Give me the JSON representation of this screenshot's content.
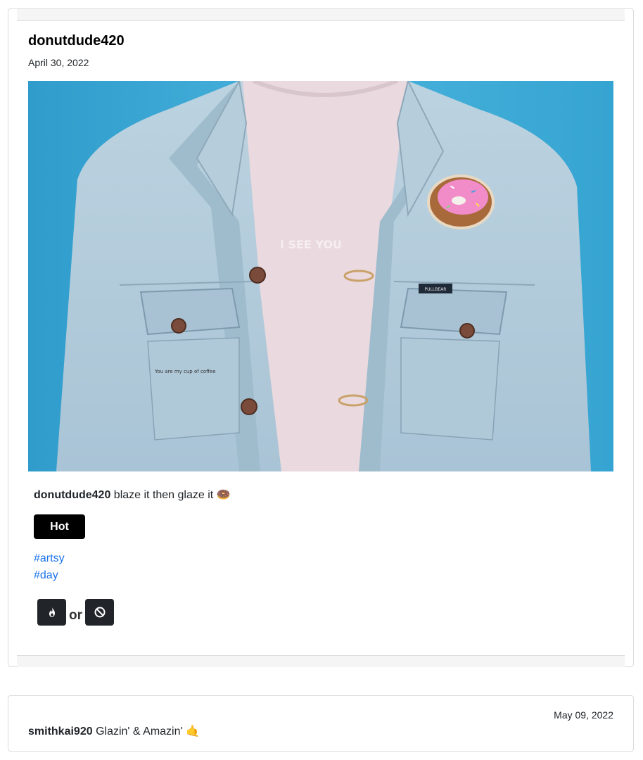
{
  "post": {
    "author": "donutdude420",
    "date": "April 30, 2022",
    "image_text": {
      "shirt_text": "I SEE YOU",
      "label_text": "PULLBEAR",
      "scribble": "You are my cup of coffee"
    },
    "caption": {
      "username": "donutdude420",
      "text": "blaze it then glaze it 🍩"
    },
    "badge": "Hot",
    "tags": [
      "#artsy",
      "#day"
    ],
    "vote": {
      "or_label": "or",
      "hot_icon": "flame-icon",
      "not_icon": "ban-icon"
    }
  },
  "comment": {
    "date": "May 09, 2022",
    "username": "smithkai920",
    "text": "Glazin' & Amazin' 🤙"
  },
  "colors": {
    "tag_link": "#1a73e8",
    "badge_bg": "#000000",
    "vote_bg": "#212529",
    "photo_bg": "#3aa7d4"
  }
}
